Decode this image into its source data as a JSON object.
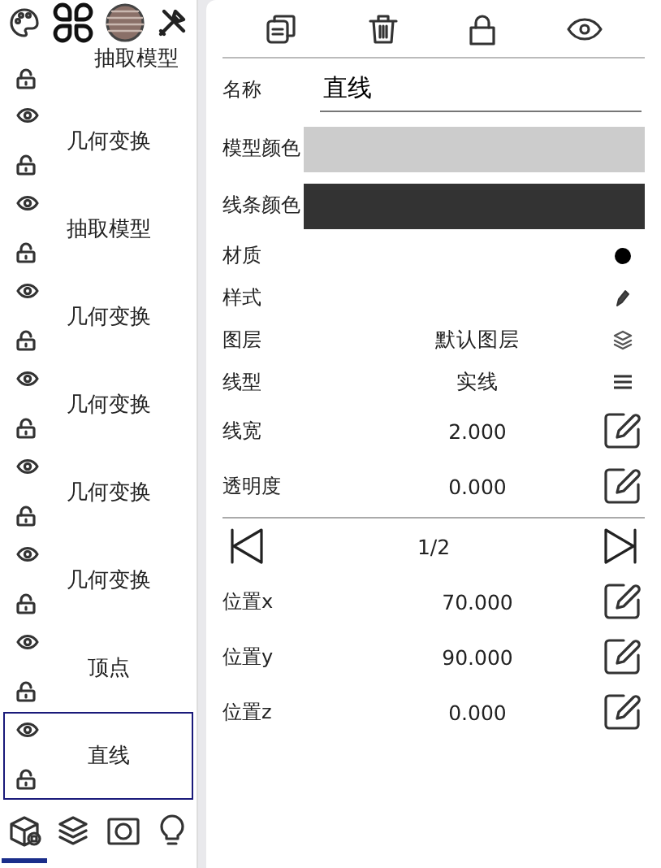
{
  "left_panel": {
    "top_tools": [
      {
        "kind": "palette"
      },
      {
        "kind": "clover"
      },
      {
        "kind": "globe"
      },
      {
        "kind": "tools"
      }
    ],
    "clipped_item": {
      "label": "抽取模型",
      "locked": false
    },
    "objects": [
      {
        "label": "几何变换",
        "visible": true,
        "locked": false,
        "selected": false
      },
      {
        "label": "抽取模型",
        "visible": true,
        "locked": false,
        "selected": false
      },
      {
        "label": "几何变换",
        "visible": true,
        "locked": false,
        "selected": false
      },
      {
        "label": "几何变换",
        "visible": true,
        "locked": false,
        "selected": false
      },
      {
        "label": "几何变换",
        "visible": true,
        "locked": false,
        "selected": false
      },
      {
        "label": "几何变换",
        "visible": true,
        "locked": false,
        "selected": false
      },
      {
        "label": "顶点",
        "visible": true,
        "locked": false,
        "selected": false
      },
      {
        "label": "直线",
        "visible": true,
        "locked": false,
        "selected": true
      }
    ],
    "bottom_tabs": [
      {
        "kind": "models",
        "selected": true
      },
      {
        "kind": "layers",
        "selected": false
      },
      {
        "kind": "photo",
        "selected": false
      },
      {
        "kind": "bulb",
        "selected": false
      }
    ]
  },
  "properties": {
    "name": {
      "label": "名称",
      "value": "直线"
    },
    "colors": [
      {
        "label": "模型颜色",
        "color": "#cccccc"
      },
      {
        "label": "线条颜色",
        "color": "#333333"
      }
    ],
    "rows": [
      {
        "label": "材质",
        "kind": "dot"
      },
      {
        "label": "样式",
        "kind": "pen"
      },
      {
        "label": "图层",
        "value": "默认图层",
        "kind": "layers"
      },
      {
        "label": "线型",
        "value": "实线",
        "kind": "lines"
      },
      {
        "label": "线宽",
        "value": "2.000",
        "kind": "edit"
      },
      {
        "label": "透明度",
        "value": "0.000",
        "kind": "edit"
      }
    ],
    "pager": {
      "page": "1/2"
    },
    "position_rows": [
      {
        "label": "位置x",
        "value": "70.000",
        "kind": "edit"
      },
      {
        "label": "位置y",
        "value": "90.000",
        "kind": "edit"
      },
      {
        "label": "位置z",
        "value": "0.000",
        "kind": "edit"
      }
    ]
  }
}
